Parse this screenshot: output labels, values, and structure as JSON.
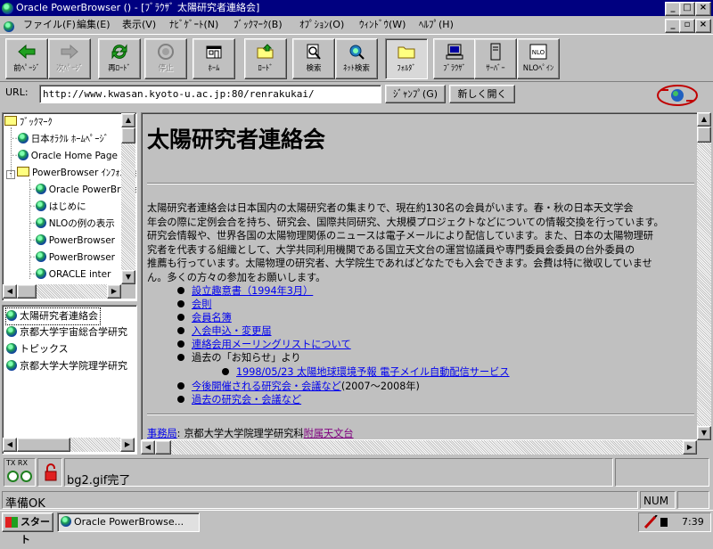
{
  "window": {
    "title": "Oracle PowerBrowser () - [ﾌﾞﾗｳｻﾞ 太陽研究者連絡会]"
  },
  "menu": [
    {
      "label": "ファイル(F)"
    },
    {
      "label": "編集(E)"
    },
    {
      "label": "表示(V)"
    },
    {
      "label": "ﾅﾋﾞｹﾞｰﾄ(N)"
    },
    {
      "label": "ﾌﾞｯｸﾏｰｸ(B)"
    },
    {
      "label": "ｵﾌﾟｼｮﾝ(O)"
    },
    {
      "label": "ｳｨﾝﾄﾞｳ(W)"
    },
    {
      "label": "ﾍﾙﾌﾟ(H)"
    }
  ],
  "toolbar": {
    "back": "前ﾍﾟｰｼﾞ",
    "forward": "次ﾍﾟｰｼﾞ",
    "reload": "再ﾛｰﾄﾞ",
    "stop": "停止",
    "home": "ﾎｰﾑ",
    "load": "ﾛｰﾄﾞ",
    "search": "検索",
    "netsearch": "ﾈｯﾄ検索",
    "folder": "ﾌｫﾙﾀﾞ",
    "browser": "ﾌﾞﾗｳｻﾞ",
    "server": "ｻｰﾊﾞｰ",
    "nlopane": "NLOﾍﾟｲﾝ",
    "nlo_icon_text": "NLO"
  },
  "address": {
    "label": "URL:",
    "value": "http://www.kwasan.kyoto-u.ac.jp:80/renrakukai/",
    "jump": "ｼﾞｬﾝﾌﾟ(G)",
    "newopen": "新しく開く"
  },
  "tree": {
    "root": "ﾌﾞｯｸﾏｰｸ",
    "items": [
      "日本ｵﾗｸﾙ ﾎｰﾑﾍﾟｰｼﾞ",
      "Oracle Home Page",
      "PowerBrowser ｲﾝﾌｫﾒｰｼｮﾝ"
    ],
    "children": [
      "Oracle PowerBrowser",
      "はじめに",
      "NLOの例の表示",
      "PowerBrowser",
      "PowerBrowser",
      "ORACLE inter"
    ]
  },
  "windowlist": [
    "太陽研究者連絡会",
    "京都大学宇宙総合学研究",
    "トピックス",
    "京都大学大学院理学研究"
  ],
  "page": {
    "title": "太陽研究者連絡会",
    "para_lines": [
      "太陽研究者連絡会は日本国内の太陽研究者の集まりで、現在約130名の会員がいます。春・秋の日本天文学会",
      "年会の際に定例会合を持ち、研究会、国際共同研究、大規模プロジェクトなどについての情報交換を行っています。",
      "研究会情報や、世界各国の太陽物理関係のニュースは電子メールにより配信しています。また、日本の太陽物理研",
      "究者を代表する組織として、大学共同利用機関である国立天文台の運営協議員や専門委員会委員の台外委員の",
      "推薦も行っています。太陽物理の研究者、大学院生であればどなたでも入会できます。会費は特に徴収していませ",
      "ん。多くの方々の参加をお願いします。"
    ],
    "links": [
      "設立趣意書（1994年3月）",
      "会則",
      "会員名簿",
      "入会申込・変更届",
      "連絡会用メーリングリストについて"
    ],
    "notice_label": "過去の「お知らせ」より",
    "notice_sub": "1998/05/23 太陽地球環境予報 電子メイル自動配信サービス",
    "link_meetings": "今後開催される研究会・会議など",
    "meetings_suffix": "(2007～2008年)",
    "link_past": "過去の研究会・会議など",
    "footer_label": "事務局",
    "footer_colon": ":",
    "footer_text": "京都大学大学院理学研究科",
    "footer_link": "附属天文台"
  },
  "status": {
    "txrx": "TX RX",
    "message": "bg2.gif完了",
    "ready": "準備OK",
    "num": "NUM"
  },
  "taskbar": {
    "start": "スタート",
    "task": "Oracle PowerBrowse...",
    "clock": "7:39"
  },
  "colors": {
    "titlebar": "#000080",
    "link": "#0000ee",
    "visited": "#800080",
    "face": "#c0c0c0"
  }
}
